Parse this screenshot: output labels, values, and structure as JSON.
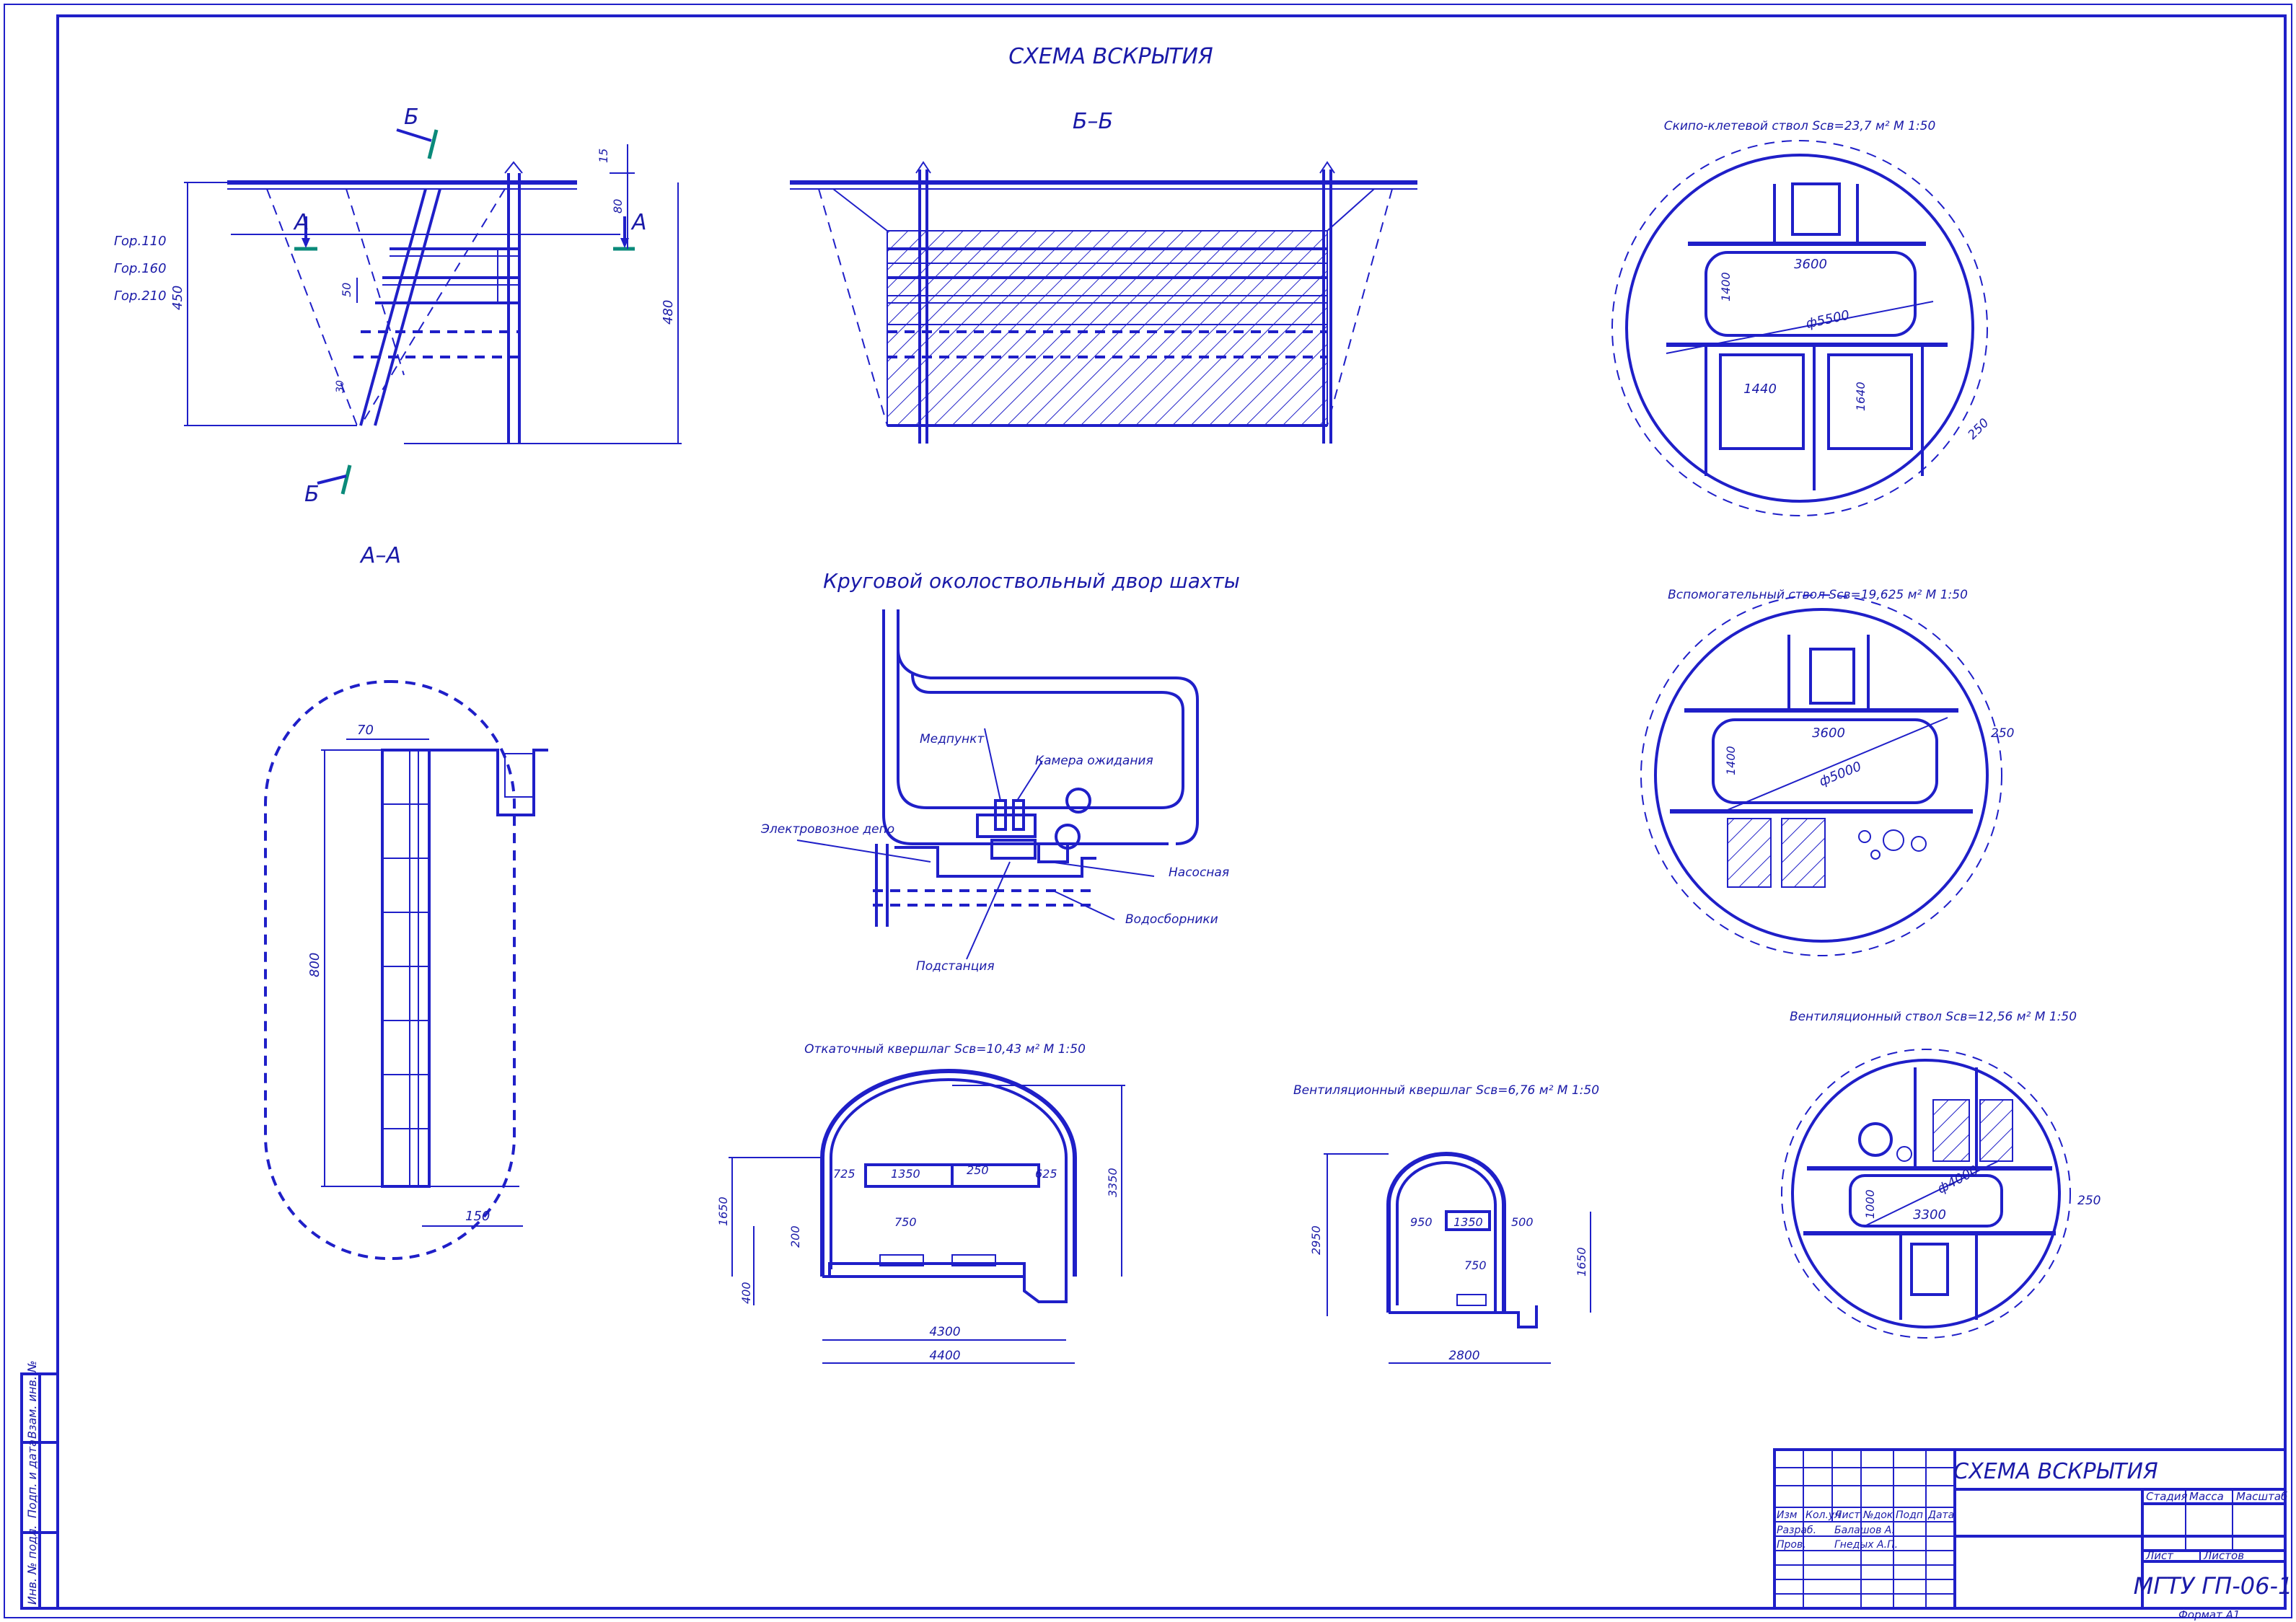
{
  "title": "СХЕМА ВСКРЫТИЯ",
  "section_bb": "Б–Б",
  "section_aa": "А–А",
  "marks": {
    "b_upper": "Б",
    "b_lower": "Б",
    "a_left": "А",
    "a_right": "А"
  },
  "horizons": [
    "Гор.110",
    "Гор.160",
    "Гор.210"
  ],
  "dims_main": {
    "d15": "15",
    "d80": "80",
    "d50": "50",
    "d450": "450",
    "d480": "480",
    "d30": "30"
  },
  "dims_aa": {
    "d70": "70",
    "d800": "800",
    "d150": "150"
  },
  "yard": {
    "title": "Круговой околоствольный двор шахты",
    "labels": {
      "medpunkt": "Медпункт",
      "kamera": "Камера ожидания",
      "depo": "Электровозное депо",
      "nasosnaya": "Насосная",
      "vodosborniki": "Водосборники",
      "podstanciya": "Подстанция"
    }
  },
  "shaft_skip": {
    "title": "Скипо-клетевой ствол Sсв=23,7 м² М 1:50",
    "dims": {
      "w": "3600",
      "h": "1400",
      "dia": "ф5500",
      "c1": "1440",
      "c2": "1640",
      "wall": "250"
    }
  },
  "shaft_aux": {
    "title": "Вспомогательный ствол Sсв=19,625 м² М 1:50",
    "dims": {
      "w": "3600",
      "h": "1400",
      "dia": "ф5000",
      "wall": "250"
    }
  },
  "shaft_vent": {
    "title": "Вентиляционный ствол Sсв=12,56 м² М 1:50",
    "dims": {
      "w": "3300",
      "h": "1000",
      "dia": "ф4000",
      "wall": "250"
    }
  },
  "haul_drift": {
    "title": "Откаточный квершлаг Sсв=10,43 м² М 1:50",
    "dims": {
      "a": "725",
      "b": "1350",
      "c": "250",
      "d": "625",
      "e": "750",
      "h1": "1650",
      "h2": "200",
      "h3": "400",
      "h4": "3350",
      "w1": "4300",
      "w2": "4400"
    }
  },
  "vent_drift": {
    "title": "Вентиляционный квершлаг Sсв=6,76 м² М 1:50",
    "dims": {
      "a": "950",
      "b": "1350",
      "c": "500",
      "e": "750",
      "h1": "2950",
      "h2": "1650",
      "w": "2800"
    }
  },
  "title_block": {
    "name": "СХЕМА ВСКРЫТИЯ",
    "code": "МГТУ ГП-06-1",
    "cols": [
      "Изм",
      "Кол.уч",
      "Лист",
      "№док",
      "Подп",
      "Дата"
    ],
    "rows": [
      {
        "role": "Разраб.",
        "person": "Балашов А."
      },
      {
        "role": "Пров.",
        "person": "Гнедых А.П."
      }
    ],
    "stage": "Стадия",
    "mass": "Масса",
    "scale": "Масштаб",
    "sheet": "Лист",
    "sheets": "Листов",
    "format": "Формат А1"
  },
  "side_stamp": [
    "Инв. № подл.",
    "Подп. и дата",
    "Взам. инв. №"
  ]
}
